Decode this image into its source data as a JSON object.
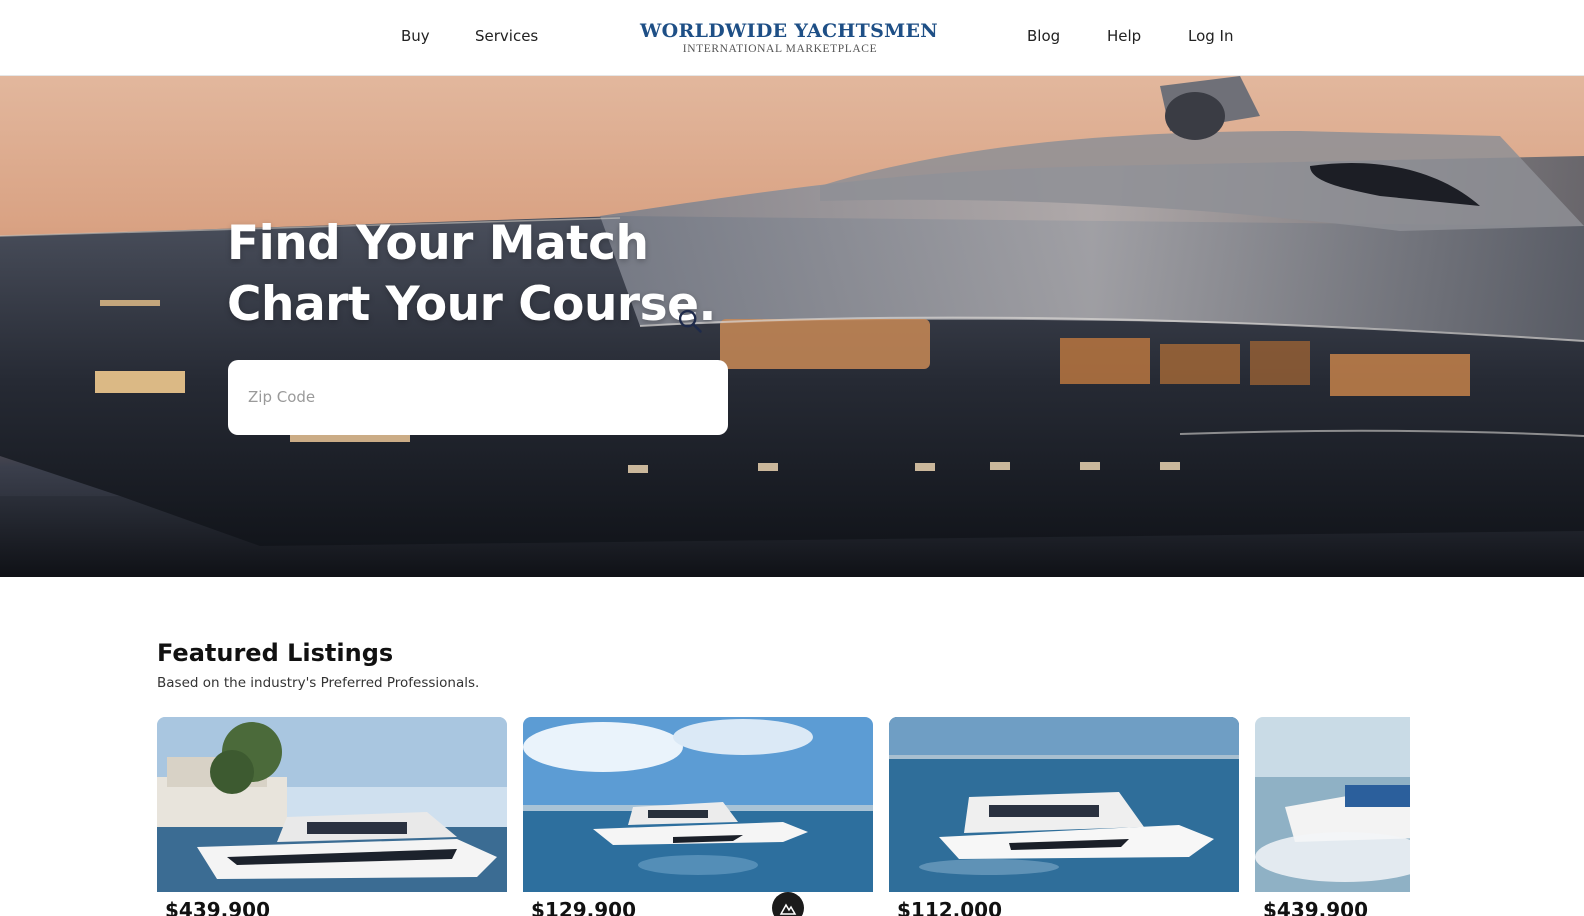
{
  "nav": {
    "left": [
      {
        "label": "Buy"
      },
      {
        "label": "Services"
      }
    ],
    "right": [
      {
        "label": "Blog"
      },
      {
        "label": "Help"
      },
      {
        "label": "Log In"
      }
    ]
  },
  "logo": {
    "title": "WORLDWIDE YACHTSMEN",
    "subtitle": "INTERNATIONAL MARKETPLACE"
  },
  "hero": {
    "title_line1": "Find Your Match",
    "title_line2": "Chart Your Course.",
    "search_placeholder": "Zip Code",
    "search_icon": "search-icon"
  },
  "featured": {
    "title": "Featured Listings",
    "subtitle": "Based on the industry's Preferred Professionals.",
    "listings": [
      {
        "price": "$439,900"
      },
      {
        "price": "$129,900"
      },
      {
        "price": "$112,000"
      },
      {
        "price": "$439,900"
      }
    ]
  },
  "colors": {
    "brand": "#1e4f86",
    "text": "#111111",
    "hero_text": "#ffffff"
  }
}
